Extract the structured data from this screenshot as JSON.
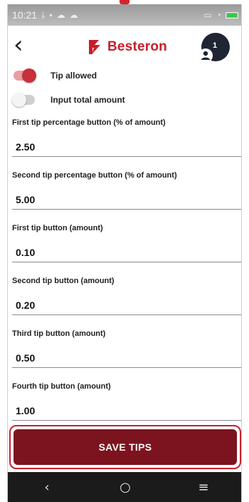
{
  "status_bar": {
    "time": "10:21",
    "left_icons": [
      "download-icon",
      "message-icon",
      "cloud-icon",
      "cloud-icon"
    ],
    "right_icons": [
      "cast-icon",
      "wifi-icon",
      "battery-icon"
    ],
    "battery_color": "#37c84a"
  },
  "app_bar": {
    "back_icon": "chevron-left-icon",
    "brand_name": "Besteron",
    "brand_color": "#c8202b",
    "notification_count": "1"
  },
  "toggles": [
    {
      "label": "Tip allowed",
      "on": true
    },
    {
      "label": "Input total amount",
      "on": false
    }
  ],
  "fields": [
    {
      "label": "First tip percentage button (% of amount)",
      "value": "2.50"
    },
    {
      "label": "Second tip percentage button (% of amount)",
      "value": "5.00"
    },
    {
      "label": "First tip button (amount)",
      "value": "0.10"
    },
    {
      "label": "Second tip button (amount)",
      "value": "0.20"
    },
    {
      "label": "Third tip button (amount)",
      "value": "0.50"
    },
    {
      "label": "Fourth tip button (amount)",
      "value": "1.00"
    }
  ],
  "save_button": {
    "label": "SAVE TIPS",
    "color": "#7c1420",
    "highlight_color": "#c8202b"
  },
  "nav_bar": {
    "back_glyph": "‹",
    "home_glyph": "○",
    "menu_glyph": "≡",
    "icons": [
      "back-icon",
      "home-icon",
      "menu-icon"
    ]
  }
}
